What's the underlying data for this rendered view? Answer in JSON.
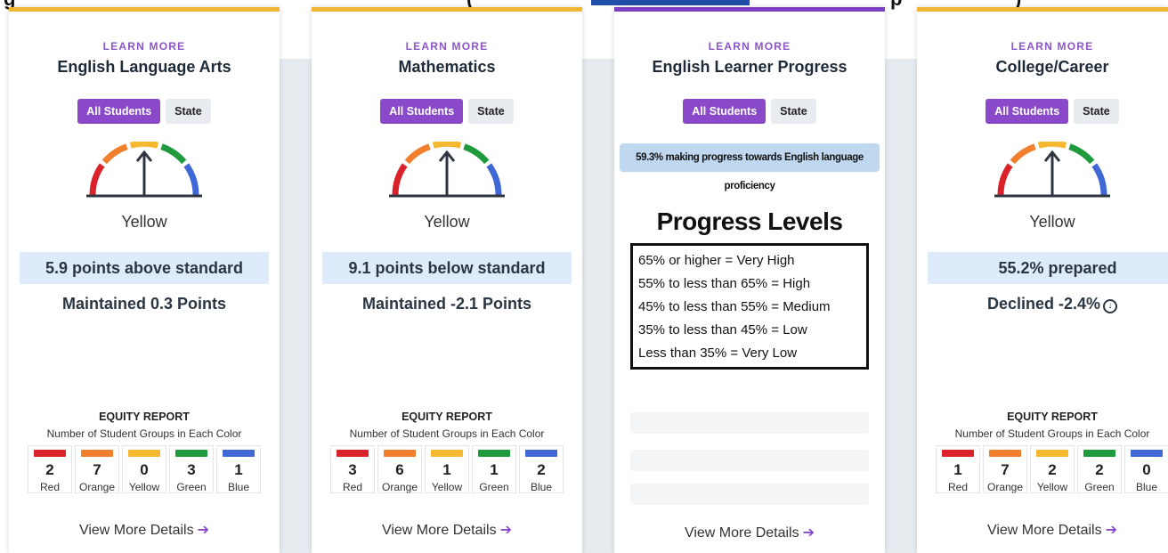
{
  "header_fragment": {
    "left": "g",
    "middle": "(",
    "right": "p",
    "paren_close": ")"
  },
  "cards": [
    {
      "learn_more": "LEARN MORE",
      "title": "English Language Arts",
      "toggle": {
        "all": "All Students",
        "state": "State"
      },
      "status_word": "Yellow",
      "points": "5.9 points above standard",
      "change": "Maintained 0.3 Points",
      "equity": {
        "title": "EQUITY REPORT",
        "subtitle": "Number of Student Groups in Each Color",
        "cells": [
          {
            "count": "2",
            "label": "Red",
            "color": "#d9222a"
          },
          {
            "count": "7",
            "label": "Orange",
            "color": "#f27f2e"
          },
          {
            "count": "0",
            "label": "Yellow",
            "color": "#f6b731"
          },
          {
            "count": "3",
            "label": "Green",
            "color": "#1f9a3c"
          },
          {
            "count": "1",
            "label": "Blue",
            "color": "#3f67d6"
          }
        ]
      },
      "details": "View More Details"
    },
    {
      "learn_more": "LEARN MORE",
      "title": "Mathematics",
      "toggle": {
        "all": "All Students",
        "state": "State"
      },
      "status_word": "Yellow",
      "points": "9.1 points below standard",
      "change": "Maintained -2.1 Points",
      "equity": {
        "title": "EQUITY REPORT",
        "subtitle": "Number of Student Groups in Each Color",
        "cells": [
          {
            "count": "3",
            "label": "Red",
            "color": "#d9222a"
          },
          {
            "count": "6",
            "label": "Orange",
            "color": "#f27f2e"
          },
          {
            "count": "1",
            "label": "Yellow",
            "color": "#f6b731"
          },
          {
            "count": "1",
            "label": "Green",
            "color": "#1f9a3c"
          },
          {
            "count": "2",
            "label": "Blue",
            "color": "#3f67d6"
          }
        ]
      },
      "details": "View More Details"
    },
    {
      "learn_more": "LEARN MORE",
      "title": "English Learner Progress",
      "toggle": {
        "all": "All Students",
        "state": "State"
      },
      "banner": "59.3% making progress towards English language proficiency",
      "progress_title": "Progress Levels",
      "levels": [
        "65% or higher = Very High",
        "55% to less than 65% = High",
        "45% to less than 55% = Medium",
        "35% to less than 45% = Low",
        "Less than 35% = Very Low"
      ],
      "details": "View More Details"
    },
    {
      "learn_more": "LEARN MORE",
      "title": "College/Career",
      "toggle": {
        "all": "All Students",
        "state": "State"
      },
      "status_word": "Yellow",
      "points": "55.2% prepared",
      "change": "Declined -2.4%",
      "change_icon": "down-circle-icon",
      "equity": {
        "title": "EQUITY REPORT",
        "subtitle": "Number of Student Groups in Each Color",
        "cells": [
          {
            "count": "1",
            "label": "Red",
            "color": "#d9222a"
          },
          {
            "count": "7",
            "label": "Orange",
            "color": "#f27f2e"
          },
          {
            "count": "2",
            "label": "Yellow",
            "color": "#f6b731"
          },
          {
            "count": "2",
            "label": "Green",
            "color": "#1f9a3c"
          },
          {
            "count": "0",
            "label": "Blue",
            "color": "#3f67d6"
          }
        ]
      },
      "details": "View More Details"
    }
  ],
  "colors": {
    "accent_purple": "#8a49c9",
    "card_top_yellow": "#f2b632",
    "card_top_purple": "#7b3fbf",
    "points_bg": "#deebfb",
    "banner_bg": "#bfd8ef"
  }
}
